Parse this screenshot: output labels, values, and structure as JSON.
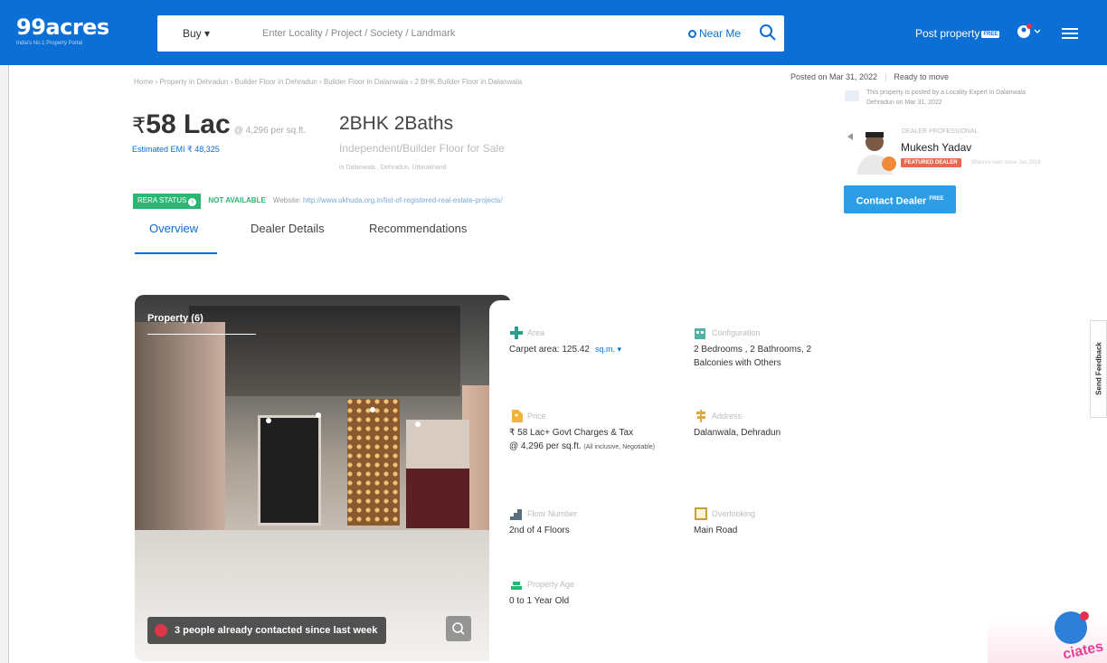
{
  "header": {
    "logo": "99acres",
    "tagline": "India's No.1 Property Portal",
    "buy_label": "Buy ▾",
    "search_placeholder": "Enter Locality / Project / Society / Landmark",
    "near_me": "Near Me",
    "post_property": "Post property",
    "post_badge": "FREE"
  },
  "breadcrumb": "Home › Property in Dehradun › Builder Floor in Dehradun › Builder Floor in Dalanwala › 2 BHK Builder Floor in Dalanwala",
  "posted": {
    "date": "Posted on Mar 31, 2022",
    "status": "Ready to move",
    "expert_note": "This property is posted by a Locality Expert in Dalanwala Dehradun on Mar 31, 2022"
  },
  "listing": {
    "currency": "₹",
    "price": "58 Lac",
    "price_per_sqft": "@ 4,296 per sq.ft.",
    "emi": "Estimated EMI ₹ 48,325",
    "bhk": "2BHK 2Baths",
    "type": "Independent/Builder Floor for Sale",
    "location": "in Dalanwala , Dehradun, Uttarakhand"
  },
  "dealer": {
    "role": "DEALER PROFESSIONAL",
    "name": "Mukesh Yadav",
    "badge": "FEATURED DEALER",
    "since": "99acres user since Jan 2018",
    "contact_label": "Contact Dealer",
    "contact_badge": "FREE"
  },
  "rera": {
    "label": "RERA STATUS",
    "status": "NOT AVAILABLE",
    "website_label": "Website:",
    "website_url": "http://www.ukhuda.org.in/list-of-registered-real-estate-projects/"
  },
  "tabs": [
    "Overview",
    "Dealer Details",
    "Recommendations"
  ],
  "gallery": {
    "title": "Property (6)",
    "contact_strip": "3 people already contacted since last week"
  },
  "details": {
    "area": {
      "label": "Area",
      "value": "Carpet area: 125.42",
      "unit": "sq.m. ▾"
    },
    "configuration": {
      "label": "Configuration",
      "value": "2 Bedrooms , 2 Bathrooms, 2 Balconies with Others"
    },
    "price": {
      "label": "Price",
      "value": "₹ 58 Lac+ Govt Charges & Tax",
      "value2": "@ 4,296 per sq.ft.",
      "note": "(All inclusive, Negotiable)"
    },
    "address": {
      "label": "Address",
      "value": "Dalanwala, Dehradun"
    },
    "floor": {
      "label": "Floor Number",
      "value": "2nd  of 4 Floors"
    },
    "overlooking": {
      "label": "Overlooking",
      "value": "Main Road"
    },
    "age": {
      "label": "Property Age",
      "value": "0 to 1 Year Old"
    }
  },
  "feedback": "Send Feedback",
  "stamp_text": "ciates",
  "colors": {
    "brand": "#0b6fd6",
    "rera_green": "#2bb673",
    "featured": "#e5694e",
    "contact_btn": "#2d9ee6"
  }
}
